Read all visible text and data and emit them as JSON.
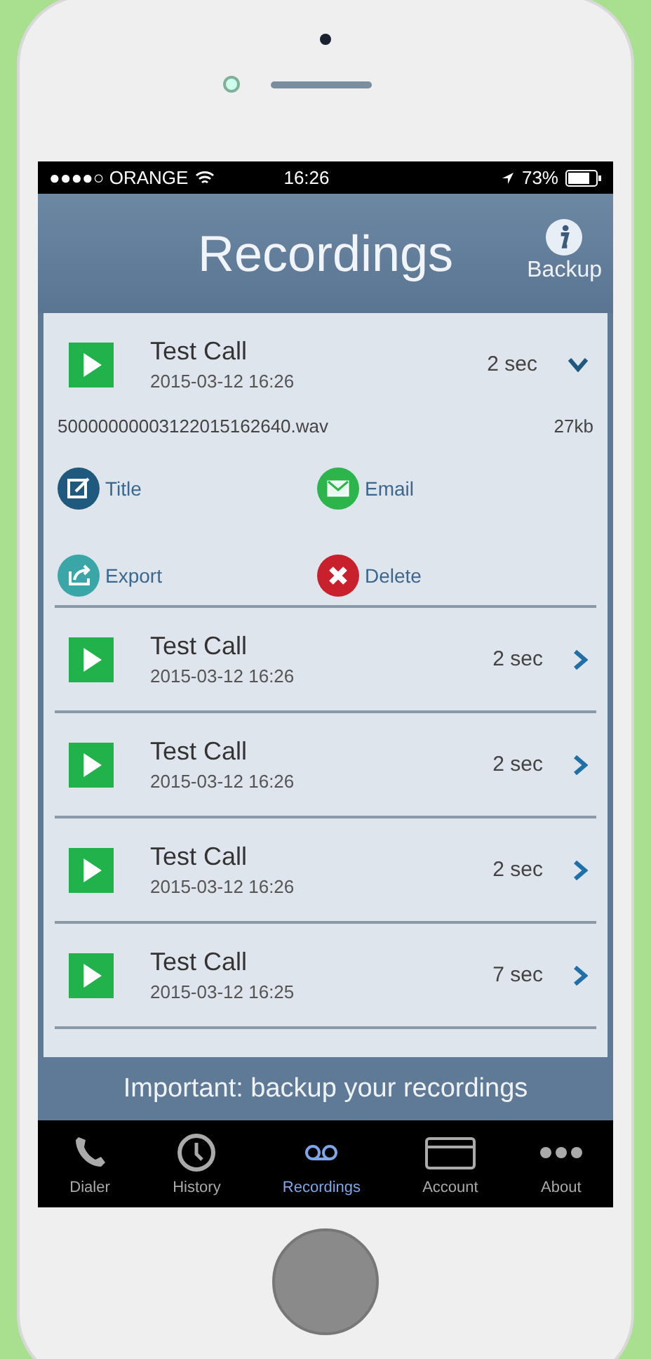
{
  "status_bar": {
    "carrier": "●●●●○ ORANGE",
    "time": "16:26",
    "battery": "73%"
  },
  "header": {
    "title": "Recordings",
    "backup": "Backup"
  },
  "recordings": [
    {
      "title": "Test Call",
      "date": "2015-03-12 16:26",
      "duration": "2 sec",
      "expanded": true,
      "file": "50000000003122015162640.wav",
      "size": "27kb",
      "actions": [
        {
          "kind": "edit",
          "label": "Title",
          "color": "#1f5a7e"
        },
        {
          "kind": "email",
          "label": "Email",
          "color": "#2bb54a"
        },
        {
          "kind": "export",
          "label": "Export",
          "color": "#3aa6a8"
        },
        {
          "kind": "delete",
          "label": "Delete",
          "color": "#c8202c"
        }
      ]
    },
    {
      "title": "Test Call",
      "date": "2015-03-12 16:26",
      "duration": "2 sec",
      "expanded": false
    },
    {
      "title": "Test Call",
      "date": "2015-03-12 16:26",
      "duration": "2 sec",
      "expanded": false
    },
    {
      "title": "Test Call",
      "date": "2015-03-12 16:26",
      "duration": "2 sec",
      "expanded": false
    },
    {
      "title": "Test Call",
      "date": "2015-03-12 16:25",
      "duration": "7 sec",
      "expanded": false
    }
  ],
  "banner": "Important: backup your recordings",
  "tabs": [
    {
      "kind": "dialer",
      "label": "Dialer",
      "selected": false
    },
    {
      "kind": "history",
      "label": "History",
      "selected": false
    },
    {
      "kind": "recordings",
      "label": "Recordings",
      "selected": true
    },
    {
      "kind": "account",
      "label": "Account",
      "selected": false
    },
    {
      "kind": "about",
      "label": "About",
      "selected": false
    }
  ]
}
